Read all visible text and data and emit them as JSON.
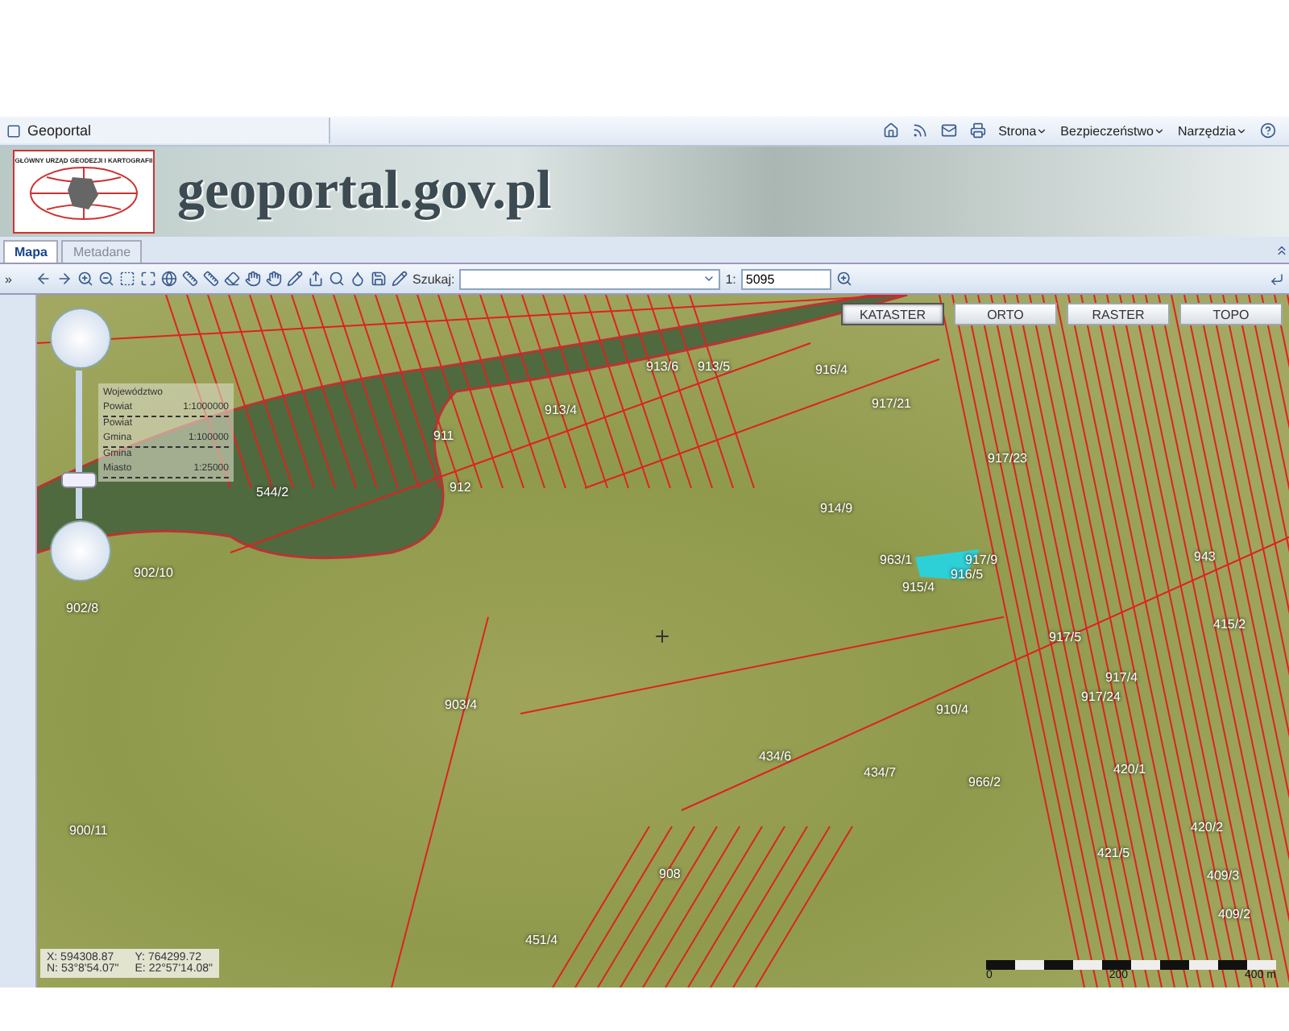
{
  "browser": {
    "tab_title": "Geoportal",
    "commands": [
      {
        "kind": "home"
      },
      {
        "kind": "feed"
      },
      {
        "kind": "mail"
      },
      {
        "kind": "print"
      },
      {
        "kind": "menu",
        "label": "Strona"
      },
      {
        "kind": "menu",
        "label": "Bezpieczeństwo"
      },
      {
        "kind": "menu",
        "label": "Narzędzia"
      },
      {
        "kind": "help"
      }
    ]
  },
  "banner": {
    "logo_text": "GŁÓWNY URZĄD GEODEZJI I KARTOGRAFII",
    "site_title": "geoportal.gov.pl"
  },
  "tabs": [
    {
      "label": "Mapa",
      "selected": true
    },
    {
      "label": "Metadane",
      "selected": false
    }
  ],
  "toolbar": {
    "expand": "»",
    "search_label": "Szukaj:",
    "scale_label": "1:",
    "scale_value": "5095"
  },
  "map": {
    "layer_buttons": [
      {
        "label": "KATASTER",
        "selected": true
      },
      {
        "label": "ORTO",
        "selected": false
      },
      {
        "label": "RASTER",
        "selected": false
      },
      {
        "label": "TOPO",
        "selected": false
      }
    ],
    "zoom": {
      "level": 0.25,
      "levels": [
        {
          "label": "Województwo"
        },
        {
          "label": "Powiat",
          "scale": "1:1000000"
        },
        {
          "label": "Powiat"
        },
        {
          "label": "Gmina",
          "scale": "1:100000"
        },
        {
          "label": "Gmina"
        },
        {
          "label": "Miasto",
          "scale": "1:25000"
        }
      ]
    },
    "parcels": [
      "913/6",
      "913/5",
      "916/4",
      "917/21",
      "913/4",
      "917/23",
      "914/9",
      "963/1",
      "917/9",
      "916/5",
      "915/4",
      "917/5",
      "910/4",
      "917/24",
      "917/4",
      "903/4",
      "434/6",
      "434/7",
      "966/2",
      "420/1",
      "420/2",
      "421/5",
      "409/3",
      "409/2",
      "908",
      "415/2",
      "943",
      "912",
      "911",
      "544/2",
      "902/10",
      "902/8",
      "451/4",
      "900/11"
    ],
    "coordinates": {
      "x": "X: 594308.87",
      "y": "Y: 764299.72",
      "n": "N: 53°8'54.07\"",
      "e": "E: 22°57'14.08\""
    },
    "scale_bar": {
      "ticks": [
        "0",
        "200",
        "400 m"
      ]
    }
  }
}
